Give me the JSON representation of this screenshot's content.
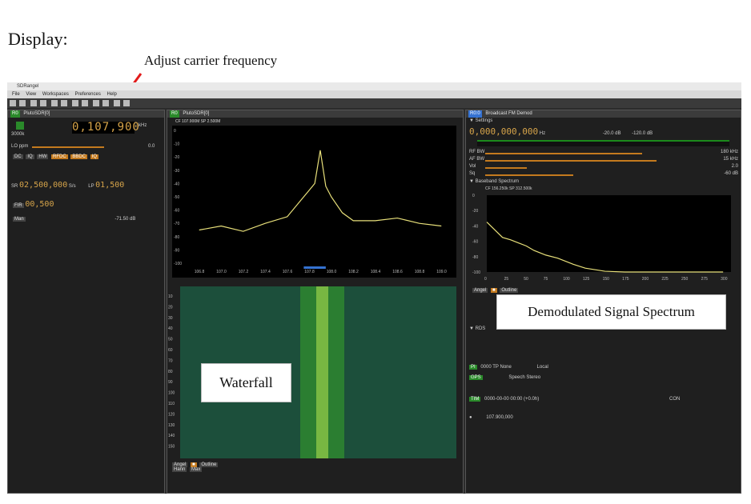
{
  "document": {
    "title": "Display:",
    "annotation": "Adjust carrier frequency"
  },
  "app": {
    "title": "SDRangel",
    "menu": [
      "File",
      "View",
      "Workspaces",
      "Preferences",
      "Help"
    ],
    "left_panel": {
      "tag": "R0",
      "name": "PlutoSDR[0]",
      "center_frequency": "0,107,900",
      "freq_unit": "kHz",
      "sample_rate": "3000k",
      "lo_ppm_label": "LO ppm",
      "lo_ppm_value": "0.0",
      "dc_label": "DC",
      "iq_label": "IQ",
      "hw_label": "HW",
      "rfdc_label": "RFDC",
      "bbdc_label": "BBDC",
      "sr_label": "SR",
      "sr_value": "02,500,000",
      "sr_unit": "S/s",
      "lp_label": "LP",
      "lp_value": "01,500",
      "fir_label": "FIR",
      "fir_value": "00,500",
      "gain_db": "-71.50 dB",
      "gain_mode": "Man"
    },
    "center_panel": {
      "tag": "R0",
      "name": "PlutoSDR[0]",
      "spectrum_info": "CF 107.900M SP 2.500M",
      "y_ticks": [
        "0",
        "-10",
        "-20",
        "-30",
        "-40",
        "-50",
        "-60",
        "-70",
        "-80",
        "-90",
        "-100"
      ],
      "x_ticks": [
        "106.8",
        "107.0",
        "107.2",
        "107.4",
        "107.6",
        "107.8",
        "108.0",
        "108.2",
        "108.4",
        "108.6",
        "108.8",
        "109.0"
      ],
      "waterfall_ticks": [
        "10",
        "20",
        "30",
        "40",
        "50",
        "60",
        "70",
        "80",
        "90",
        "100",
        "110",
        "120",
        "130",
        "140",
        "150"
      ],
      "bottom_labels": [
        "Angel",
        "Outline",
        "Hann",
        "Max"
      ]
    },
    "right_panel": {
      "tag": "R0:0",
      "name": "Broadcast FM Demod",
      "settings_label": "Settings",
      "channel_frequency": "0,000,000,000",
      "freq_unit": "Hz",
      "level_db": "-20.0 dB",
      "squelch_db": "-120.0 dB",
      "rf_bw_label": "RF BW",
      "rf_bw_value": "180 kHz",
      "af_bw_label": "AF BW",
      "af_bw_value": "15 kHz",
      "vol_label": "Vol",
      "vol_value": "2.0",
      "sq_label": "Sq",
      "sq_value": "-60 dB",
      "baseband_label": "Baseband Spectrum",
      "baseband_info": "CF 156.250k SP 312.500k",
      "bb_y_ticks": [
        "0",
        "-20",
        "-40",
        "-60",
        "-80",
        "-100"
      ],
      "bb_x_ticks": [
        "0",
        "25",
        "50",
        "75",
        "100",
        "125",
        "150",
        "175",
        "200",
        "225",
        "250",
        "275",
        "300"
      ],
      "rds_label": "RDS",
      "pi_label": "PI",
      "pi_value": "0000",
      "tp_label": "TP",
      "tp_value": "None",
      "local_label": "Local",
      "gps_label": "GPS",
      "speech_label": "Speech",
      "stereo_label": "Stereo",
      "time_label": "TIM",
      "time_value": "0000-00-00 00:00 (+0.0h)",
      "con_label": "CON",
      "channel_readout": "107.900,000"
    }
  },
  "labels": {
    "waterfall": "Waterfall",
    "demod": "Demodulated Signal Spectrum"
  },
  "chart_data": [
    {
      "type": "line",
      "title": "CF 107.900M SP 2.500M",
      "x": [
        106.8,
        107.0,
        107.2,
        107.4,
        107.6,
        107.7,
        107.8,
        107.85,
        107.9,
        107.95,
        108.0,
        108.1,
        108.2,
        108.4,
        108.6,
        108.8,
        109.0
      ],
      "y": [
        -75,
        -72,
        -76,
        -70,
        -65,
        -55,
        -45,
        -40,
        -15,
        -42,
        -50,
        -62,
        -68,
        -68,
        -66,
        -70,
        -72
      ],
      "xlim": [
        106.7,
        109.1
      ],
      "ylim": [
        -100,
        0
      ],
      "grid": false
    },
    {
      "type": "line",
      "title": "CF 156.250k SP 312.500k",
      "x": [
        0,
        10,
        20,
        30,
        40,
        50,
        60,
        75,
        90,
        100,
        110,
        125,
        150,
        175,
        200,
        250,
        300
      ],
      "y": [
        -35,
        -45,
        -55,
        -58,
        -62,
        -66,
        -72,
        -78,
        -82,
        -86,
        -90,
        -95,
        -99,
        -100,
        -100,
        -100,
        -100
      ],
      "xlim": [
        0,
        310
      ],
      "ylim": [
        -100,
        0
      ],
      "grid": false
    }
  ]
}
